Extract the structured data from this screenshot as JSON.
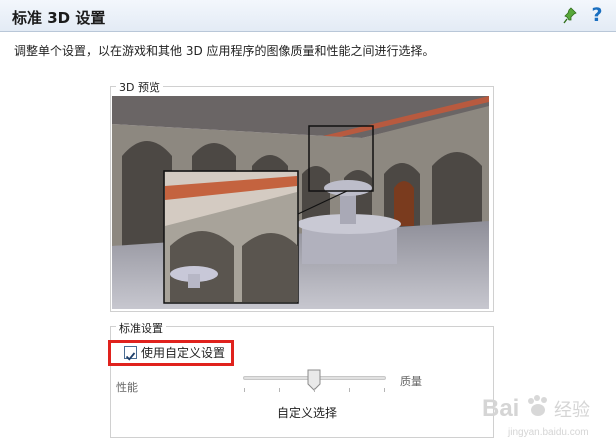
{
  "header": {
    "title": "标准 3D 设置"
  },
  "description": "调整单个设置，以在游戏和其他 3D 应用程序的图像质量和性能之间进行选择。",
  "preview": {
    "legend": "3D 预览"
  },
  "standard_settings": {
    "legend": "标准设置",
    "custom_checkbox_label": "使用自定义设置",
    "custom_checked": true,
    "slider_left_label": "性能",
    "slider_right_label": "质量",
    "slider_caption": "自定义选择",
    "slider_position_fraction": 0.5
  },
  "colors": {
    "accent_red": "#e0221d",
    "header_bg": "#e3ebf5",
    "help_blue": "#1a6fc0"
  },
  "icons": [
    "pin-icon",
    "help-icon",
    "checkmark-icon",
    "slider-thumb"
  ],
  "watermark": {
    "text": "Bai",
    "suffix": "经验",
    "url_text": "jingyan.baidu.com"
  }
}
